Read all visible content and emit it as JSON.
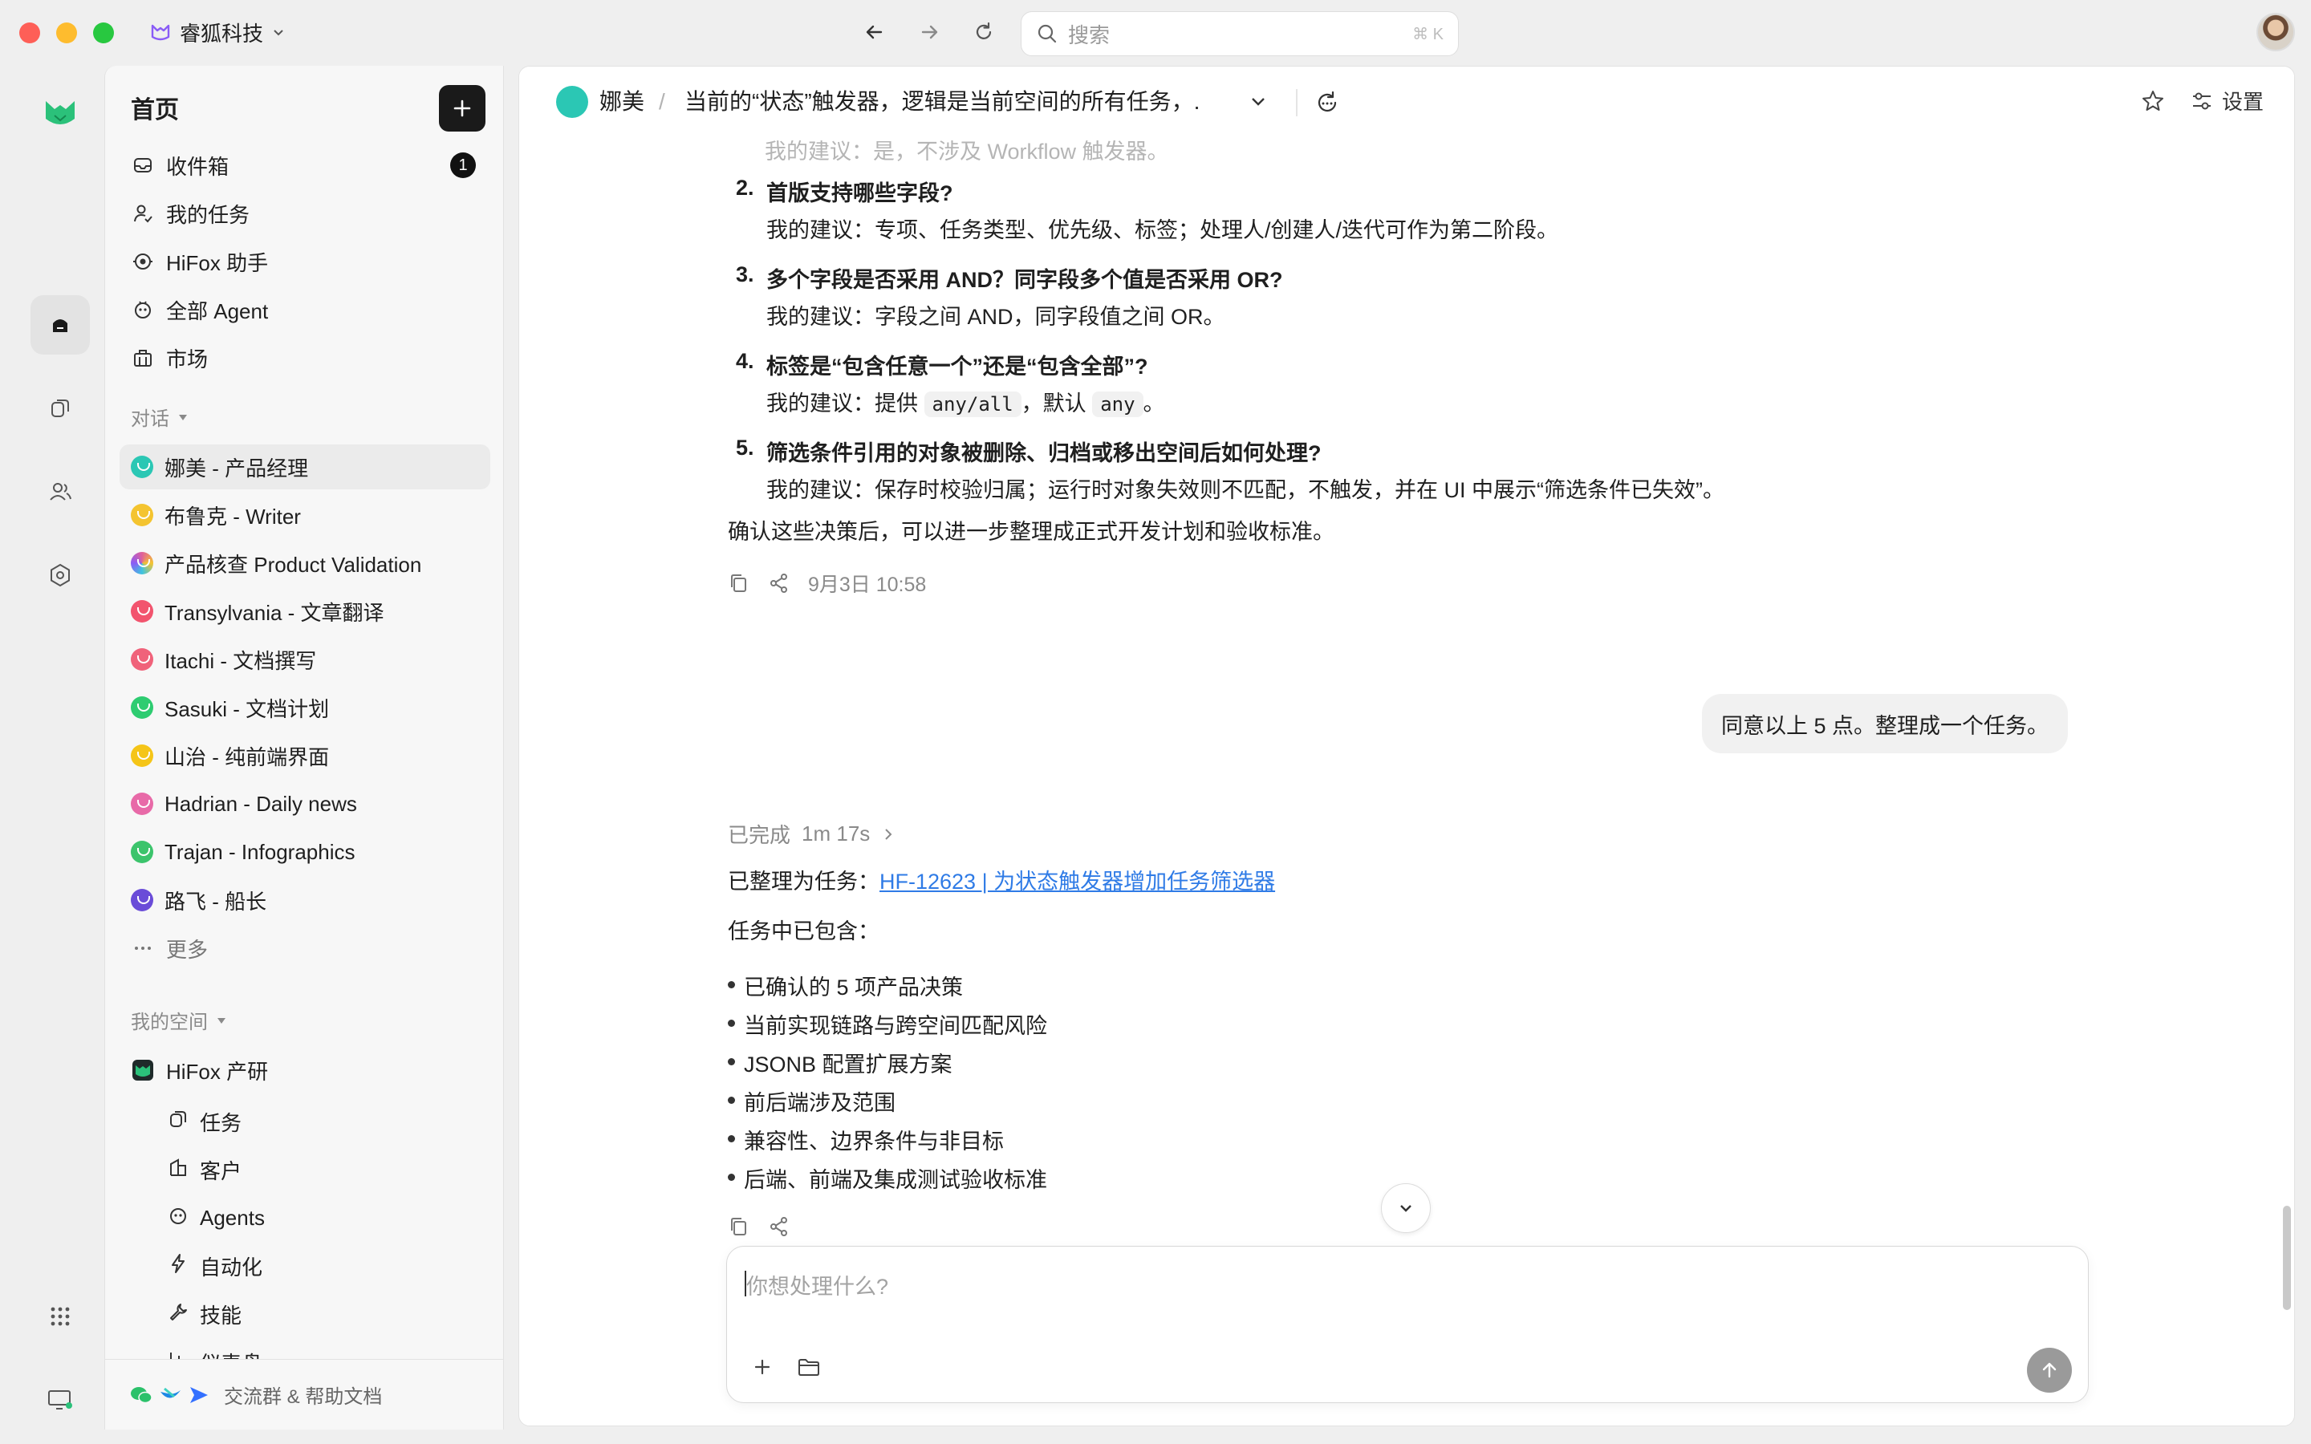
{
  "titlebar": {
    "workspace": "睿狐科技",
    "search_placeholder": "搜索",
    "search_shortcut": "⌘ K"
  },
  "sidebar": {
    "title": "首页",
    "nav": [
      {
        "label": "收件箱",
        "icon": "inbox-icon",
        "badge": "1"
      },
      {
        "label": "我的任务",
        "icon": "user-task-icon"
      },
      {
        "label": "HiFox 助手",
        "icon": "assistant-icon"
      },
      {
        "label": "全部 Agent",
        "icon": "agent-icon"
      },
      {
        "label": "市场",
        "icon": "market-icon"
      }
    ],
    "conversations_label": "对话",
    "conversations": [
      {
        "label": "娜美 - 产品经理",
        "color": "#2bc7b4"
      },
      {
        "label": "布鲁克 - Writer",
        "color": "#f4c430"
      },
      {
        "label": "产品核查 Product Validation",
        "color": "#e0609a"
      },
      {
        "label": "Transylvania - 文章翻译",
        "color": "#f2546e"
      },
      {
        "label": "Itachi - 文档撰写",
        "color": "#f0627a"
      },
      {
        "label": "Sasuki - 文档计划",
        "color": "#2ecc71"
      },
      {
        "label": "山治 - 纯前端界面",
        "color": "#f5c518"
      },
      {
        "label": "Hadrian - Daily news",
        "color": "#e86aa8"
      },
      {
        "label": "Trajan - Infographics",
        "color": "#3cc46c"
      },
      {
        "label": "路飞 - 船长",
        "color": "#6a4cd8"
      }
    ],
    "more_label": "更多",
    "space_label": "我的空间",
    "space_name": "HiFox 产研",
    "space_items": [
      {
        "label": "任务",
        "icon": "task-icon"
      },
      {
        "label": "客户",
        "icon": "customer-icon"
      },
      {
        "label": "Agents",
        "icon": "agents-icon"
      },
      {
        "label": "自动化",
        "icon": "lightning-icon"
      },
      {
        "label": "技能",
        "icon": "wrench-icon"
      },
      {
        "label": "仪表盘",
        "icon": "dashboard-icon"
      }
    ],
    "footer": "交流群 & 帮助文档"
  },
  "header": {
    "agent_name": "娜美",
    "title": "当前的“状态”触发器，逻辑是当前空间的所有任务，...",
    "settings_label": "设置"
  },
  "chat": {
    "faded_line": "我的建议：是，不涉及 Workflow 触发器。",
    "questions": [
      {
        "num": "2.",
        "q": "首版支持哪些字段?",
        "a": "我的建议：专项、任务类型、优先级、标签；处理人/创建人/迭代可作为第二阶段。"
      },
      {
        "num": "3.",
        "q": "多个字段是否采用 AND？同字段多个值是否采用 OR?",
        "a": "我的建议：字段之间 AND，同字段值之间 OR。"
      },
      {
        "num": "4.",
        "q": "标签是“包含任意一个”还是“包含全部”?",
        "a_prefix": "我的建议：提供 ",
        "code1": "any/all",
        "a_mid": "，默认 ",
        "code2": "any",
        "a_suffix": "。"
      },
      {
        "num": "5.",
        "q": "筛选条件引用的对象被删除、归档或移出空间后如何处理?",
        "a": "我的建议：保存时校验归属；运行时对象失效则不匹配，不触发，并在 UI 中展示“筛选条件已失效”。"
      }
    ],
    "conclusion": "确认这些决策后，可以进一步整理成正式开发计划和验收标准。",
    "timestamp": "9月3日 10:58",
    "user_message": "同意以上 5 点。整理成一个任务。",
    "status_label": "已完成",
    "duration": "1m 17s",
    "task_prefix": "已整理为任务：",
    "task_link": "HF-12623 | 为状态触发器增加任务筛选器",
    "includes_label": "任务中已包含：",
    "bullets": [
      "已确认的 5 项产品决策",
      "当前实现链路与跨空间匹配风险",
      "JSONB 配置扩展方案",
      "前后端涉及范围",
      "兼容性、边界条件与非目标",
      "后端、前端及集成测试验收标准"
    ]
  },
  "composer": {
    "placeholder": "你想处理什么?"
  }
}
